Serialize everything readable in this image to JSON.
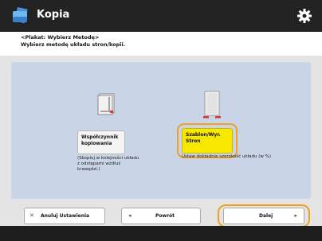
{
  "app": {
    "title": "Kopia"
  },
  "instructions": {
    "line1": "<Plakat: Wybierz Metodę>",
    "line2": "Wybierz metodę układu stron/kopii."
  },
  "options": [
    {
      "label_line1": "Współczynnik",
      "label_line2": "kopiowania",
      "description": "(Skopiuj w kolejności układu z odstępami wzdłuż krawędzi.)",
      "selected": false
    },
    {
      "label_line1": "Szablon/Wyr.",
      "label_line2": "Stron",
      "description": "Ustaw dokładnie szerokość układu (w %)",
      "selected": true
    }
  ],
  "buttons": {
    "cancel": "Anuluj Ustawienia",
    "back": "Powrót",
    "next": "Dalej"
  },
  "colors": {
    "accent": "#f0a020",
    "selected_fill": "#f8e800",
    "panel": "#c9d5e6",
    "titlebar": "#232323"
  }
}
